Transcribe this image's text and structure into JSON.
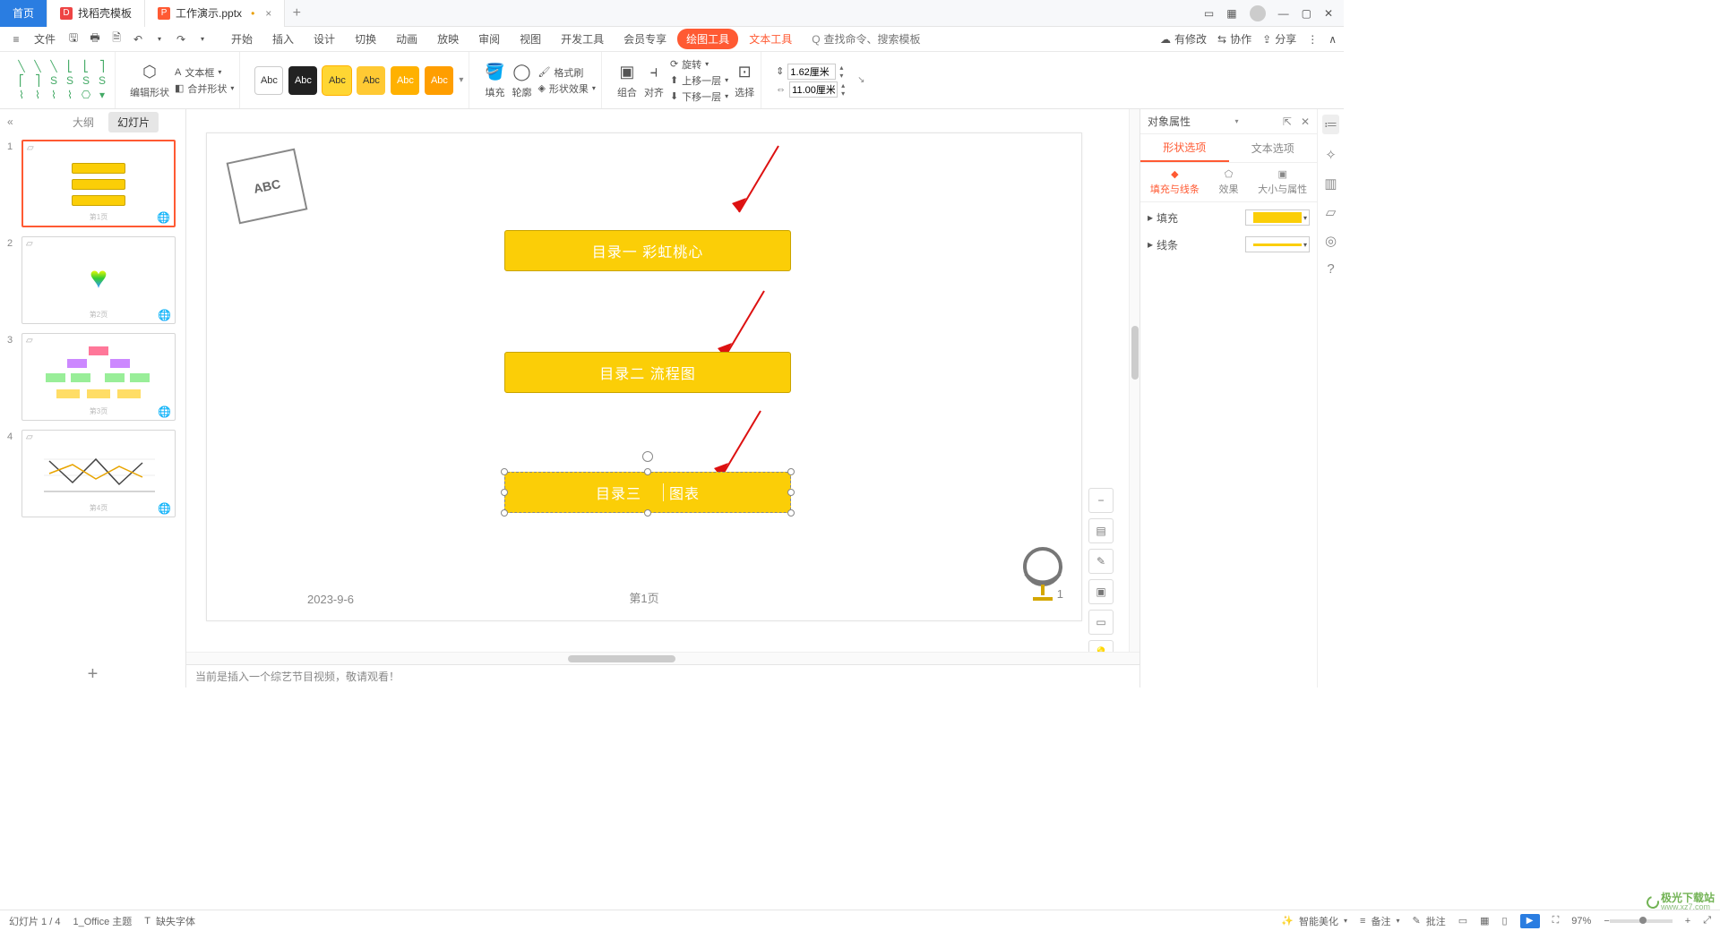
{
  "tabs": {
    "home": "首页",
    "tpl": "找稻壳模板",
    "active": "工作演示.pptx"
  },
  "menubar": {
    "file": "文件"
  },
  "ribbon_tabs": [
    "开始",
    "插入",
    "设计",
    "切换",
    "动画",
    "放映",
    "审阅",
    "视图",
    "开发工具",
    "会员专享"
  ],
  "ribbon_active": "绘图工具",
  "ribbon_text_tool": "文本工具",
  "search": {
    "hint": "查找命令、搜索模板",
    "icon": "Q"
  },
  "top_right": {
    "unsaved": "有修改",
    "collab": "协作",
    "share": "分享"
  },
  "rb": {
    "edit_shape": "编辑形状",
    "merge_shape": "合并形状",
    "textbox": "文本框",
    "swatch_label": "Abc",
    "fill": "填充",
    "outline": "轮廓",
    "shape_fx": "形状效果",
    "fmt_painter": "格式刷",
    "group": "组合",
    "align": "对齐",
    "rotate": "旋转",
    "forward": "上移一层",
    "backward": "下移一层",
    "select": "选择",
    "width": "1.62厘米",
    "height": "11.00厘米"
  },
  "outline": {
    "tab_outline": "大纲",
    "tab_slides": "幻灯片"
  },
  "slide": {
    "toc1": "目录一  彩虹桃心",
    "toc2": "目录二    流程图",
    "toc3_a": "目录三",
    "toc3_b": "图表",
    "date": "2023-9-6",
    "page": "第1页",
    "num": "1",
    "abc": "ABC"
  },
  "notebar": "当前是插入一个综艺节目视频，敬请观看！",
  "rpane": {
    "title": "对象属性",
    "tab_shape": "形状选项",
    "tab_text": "文本选项",
    "sub_fill": "填充与线条",
    "sub_fx": "效果",
    "sub_size": "大小与属性",
    "fill": "填充",
    "line": "线条"
  },
  "status": {
    "slide": "幻灯片 1 / 4",
    "theme": "1_Office 主题",
    "missing": "缺失字体",
    "beautify": "智能美化",
    "notes": "备注",
    "comments": "批注",
    "zoom": "97%"
  },
  "watermark": "极光下载站",
  "watermark_sub": "www.xz7.com"
}
